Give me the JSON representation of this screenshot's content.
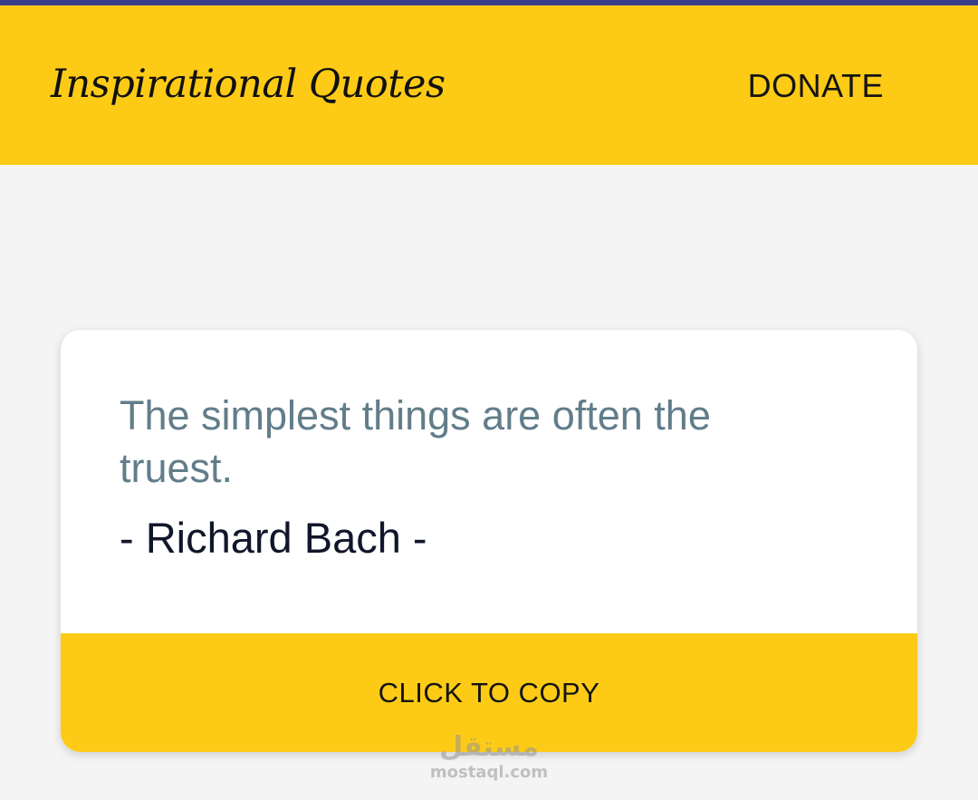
{
  "status_strip": {
    "color": "#3a3f8c"
  },
  "app_bar": {
    "title": "Inspirational Quotes",
    "donate_label": "DONATE",
    "color": "#fdcb16"
  },
  "quote_card": {
    "text": "The simplest things are often the truest.",
    "author": "- Richard Bach -",
    "copy_label": "CLICK TO COPY",
    "text_color": "#627d8a",
    "author_color": "#10172a"
  },
  "watermark": {
    "arabic": "مستقل",
    "domain": "mostaql.com"
  }
}
